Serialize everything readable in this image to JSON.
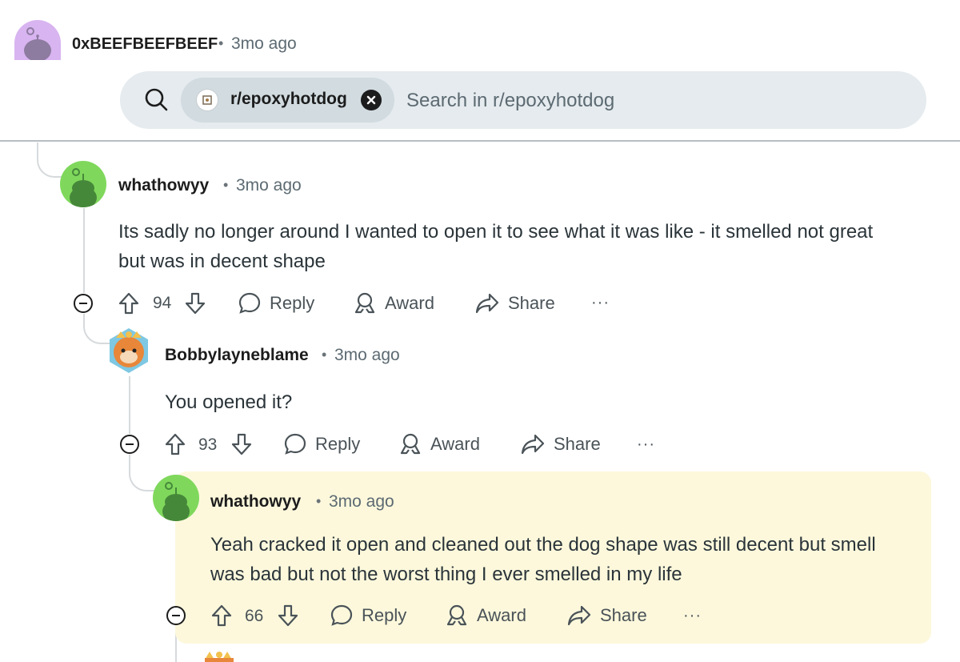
{
  "top_comment": {
    "username": "0xBEEFBEEFBEEF",
    "time": "3mo ago"
  },
  "search": {
    "chip_label": "r/epoxyhotdog",
    "placeholder": "Search in r/epoxyhotdog"
  },
  "comments": [
    {
      "username": "whathowyy",
      "time": "3mo ago",
      "text_line1": "Its sadly no longer around I wanted to open it to see what it was like - it smelled not great",
      "text_line2": "but was in decent shape",
      "votes": "94"
    },
    {
      "username": "Bobbylayneblame",
      "time": "3mo ago",
      "text_line1": "You opened it?",
      "votes": "93"
    },
    {
      "username": "whathowyy",
      "time": "3mo ago",
      "text_line1": "Yeah cracked it open and cleaned out the dog shape was still decent but smell",
      "text_line2": "was bad but not the worst thing I ever smelled in my life",
      "votes": "66"
    }
  ],
  "actions": {
    "reply": "Reply",
    "award": "Award",
    "share": "Share",
    "more": "···"
  },
  "colors": {
    "highlight_bg": "#fdf8dc",
    "search_bg": "#e5ebee",
    "chip_bg": "#d1dbe0",
    "green_avatar": "#7fd85c",
    "purple_avatar": "#d8b4f0"
  }
}
